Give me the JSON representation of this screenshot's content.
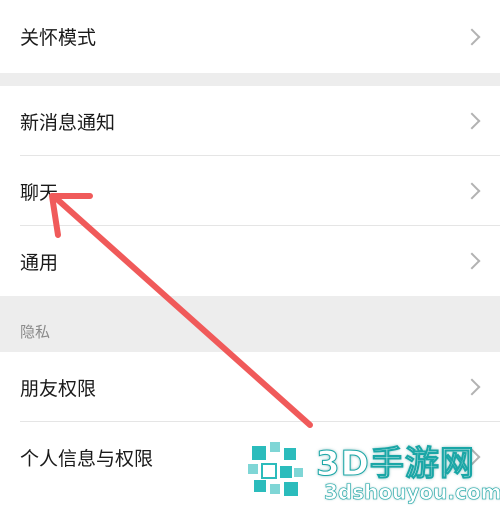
{
  "settings": {
    "group1": [
      {
        "id": "care-mode",
        "label": "关怀模式"
      }
    ],
    "group2": [
      {
        "id": "new-message-notification",
        "label": "新消息通知"
      },
      {
        "id": "chat",
        "label": "聊天"
      },
      {
        "id": "general",
        "label": "通用"
      }
    ],
    "privacy_section_title": "隐私",
    "group3": [
      {
        "id": "friend-permissions",
        "label": "朋友权限"
      },
      {
        "id": "personal-info-permissions",
        "label": "个人信息与权限"
      }
    ]
  },
  "annotation": {
    "arrow_color": "#f05a5a",
    "arrow_target": "聊天"
  },
  "watermark": {
    "title": "3D手游网",
    "subtitle": "3dshouyou.com",
    "color": "#1aa6a6"
  },
  "icons": {
    "row_chevron": "chevron-right-icon"
  }
}
